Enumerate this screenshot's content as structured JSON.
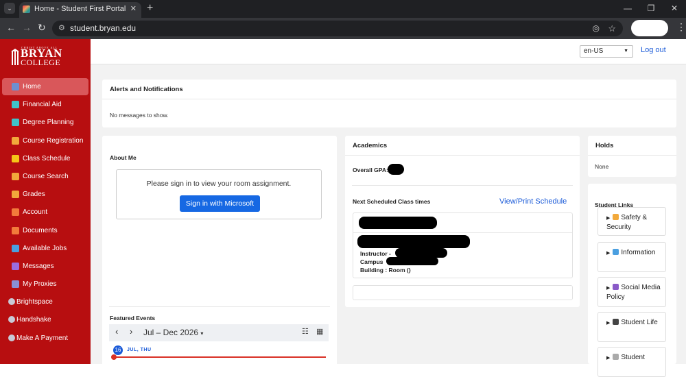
{
  "browser": {
    "tab_title": "Home - Student First Portal",
    "url": "student.bryan.edu"
  },
  "logo": {
    "line1": "CHRIST ABOVE ALL",
    "line2": "BRYAN",
    "line3": "COLLEGE"
  },
  "sidebar": {
    "items": [
      {
        "label": "Home",
        "icon": "home-icon",
        "color": "#6f8fd0"
      },
      {
        "label": "Financial Aid",
        "icon": "financial-aid-icon",
        "color": "#3fc3c9"
      },
      {
        "label": "Degree Planning",
        "icon": "degree-planning-icon",
        "color": "#3fc3c9"
      },
      {
        "label": "Course Registration",
        "icon": "graduation-cap-icon",
        "color": "#f2a93b"
      },
      {
        "label": "Class Schedule",
        "icon": "calendar-icon",
        "color": "#f5c518"
      },
      {
        "label": "Course Search",
        "icon": "search-icon",
        "color": "#f2a93b"
      },
      {
        "label": "Grades",
        "icon": "grades-icon",
        "color": "#f2a93b"
      },
      {
        "label": "Account",
        "icon": "account-icon",
        "color": "#f27b3b"
      },
      {
        "label": "Documents",
        "icon": "documents-icon",
        "color": "#f27b3b"
      },
      {
        "label": "Available Jobs",
        "icon": "briefcase-icon",
        "color": "#4a9fe0"
      },
      {
        "label": "Messages",
        "icon": "messages-icon",
        "color": "#9b6ce0"
      },
      {
        "label": "My Proxies",
        "icon": "proxies-icon",
        "color": "#8a8fd6"
      }
    ],
    "external": [
      {
        "label": "Brightspace",
        "icon": "globe-icon"
      },
      {
        "label": "Handshake",
        "icon": "globe-icon"
      },
      {
        "label": "Make A Payment",
        "icon": "globe-icon"
      }
    ]
  },
  "header": {
    "language": "en-US",
    "logout": "Log out"
  },
  "alerts": {
    "title": "Alerts and Notifications",
    "message": "No messages to show."
  },
  "about": {
    "title": "About Me",
    "signin_message": "Please sign in to view your room assignment.",
    "signin_button": "Sign in with Microsoft",
    "featured_events": "Featured Events",
    "calendar_range": "Jul – Dec 2026",
    "day_number": "16",
    "day_label": "JUL, THU"
  },
  "academics": {
    "title": "Academics",
    "gpa_label": "Overall GPA:",
    "next_class_label": "Next Scheduled Class times",
    "view_schedule": "View/Print Schedule",
    "instructor_label": "Instructor -",
    "campus_label": "Campus",
    "building_label": "Building : Room ()"
  },
  "holds": {
    "title": "Holds",
    "value": "None"
  },
  "student_links": {
    "title": "Student Links",
    "items": [
      {
        "label": "Safety & Security",
        "icon": "lock-icon",
        "color": "#f2a93b"
      },
      {
        "label": "Information",
        "icon": "info-icon",
        "color": "#4a9fe0"
      },
      {
        "label": "Social Media Policy",
        "icon": "book-icon",
        "color": "#8a5ac8"
      },
      {
        "label": "Student Life",
        "icon": "graduation-cap-icon",
        "color": "#444444"
      },
      {
        "label": "Student",
        "icon": "link-icon",
        "color": "#aaaaaa"
      }
    ]
  }
}
